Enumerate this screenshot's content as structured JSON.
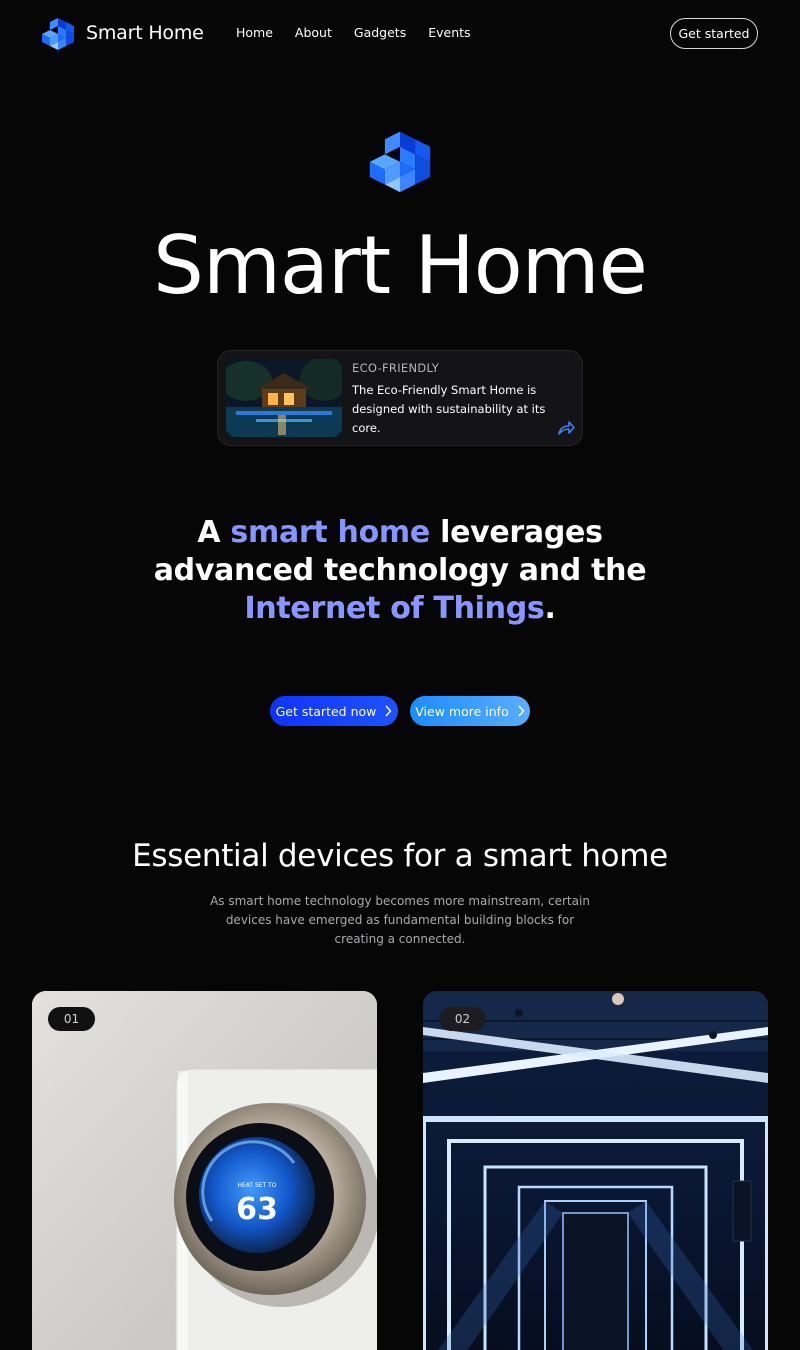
{
  "nav": {
    "brand": "Smart Home",
    "links": [
      {
        "label": "Home"
      },
      {
        "label": "About"
      },
      {
        "label": "Gadgets"
      },
      {
        "label": "Events"
      }
    ],
    "cta": "Get started",
    "logo_icon": "stacked-cubes-logo"
  },
  "hero": {
    "title": "Smart Home",
    "logo_icon": "stacked-cubes-logo"
  },
  "feature": {
    "tag": "ECO-FRIENDLY",
    "text": "The Eco-Friendly Smart Home is designed with sustainability at its core.",
    "icon": "share-arrow-icon"
  },
  "headline": {
    "part1": "A ",
    "highlight1": "smart home",
    "part2": " leverages advanced technology and the ",
    "highlight2": "Internet of Things",
    "part3": "."
  },
  "buttons": {
    "primary": "Get started now",
    "secondary": "View more info"
  },
  "section": {
    "title": "Essential devices for a smart home",
    "description": "As smart home technology becomes more mainstream, certain devices have emerged as fundamental building blocks for creating a connected."
  },
  "devices": [
    {
      "index": "01",
      "image": "smart-thermostat",
      "display": "63",
      "display_label": "HEAT SET TO"
    },
    {
      "index": "02",
      "image": "smart-lighting-corridor"
    }
  ],
  "colors": {
    "background": "#060607",
    "highlight": "#8597ff",
    "primary_button": "#0f33ff",
    "secondary_button": "#3a9cff",
    "logo_blue": "#1f6bff"
  }
}
